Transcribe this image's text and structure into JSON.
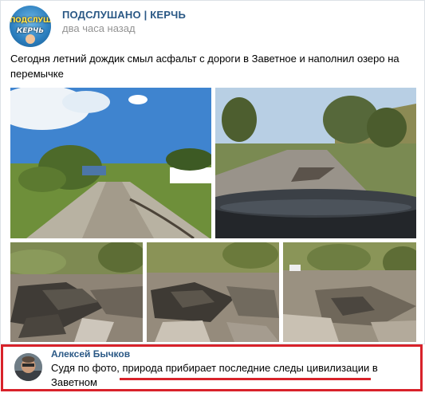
{
  "post": {
    "group_name": "ПОДСЛУШАНО | КЕРЧЬ",
    "time": "два часа назад",
    "text": "Сегодня летний дождик смыл асфальт с дороги в Заветное и наполнил озеро на перемычке",
    "avatar_text_line1": "ПОДСЛУШАНО",
    "avatar_text_line2": "КЕРЧЬ",
    "photos": [
      "road-with-fallen-tree",
      "damaged-road-car-hood",
      "washed-out-road-1",
      "washed-out-road-2",
      "washed-out-road-car"
    ]
  },
  "comment": {
    "author": "Алексей Бычков",
    "text": "Судя по фото, природа прибирает последние следы цивилизации в Заветном"
  },
  "colors": {
    "link": "#2a5885",
    "muted": "#939393",
    "highlight": "#d8222a"
  }
}
